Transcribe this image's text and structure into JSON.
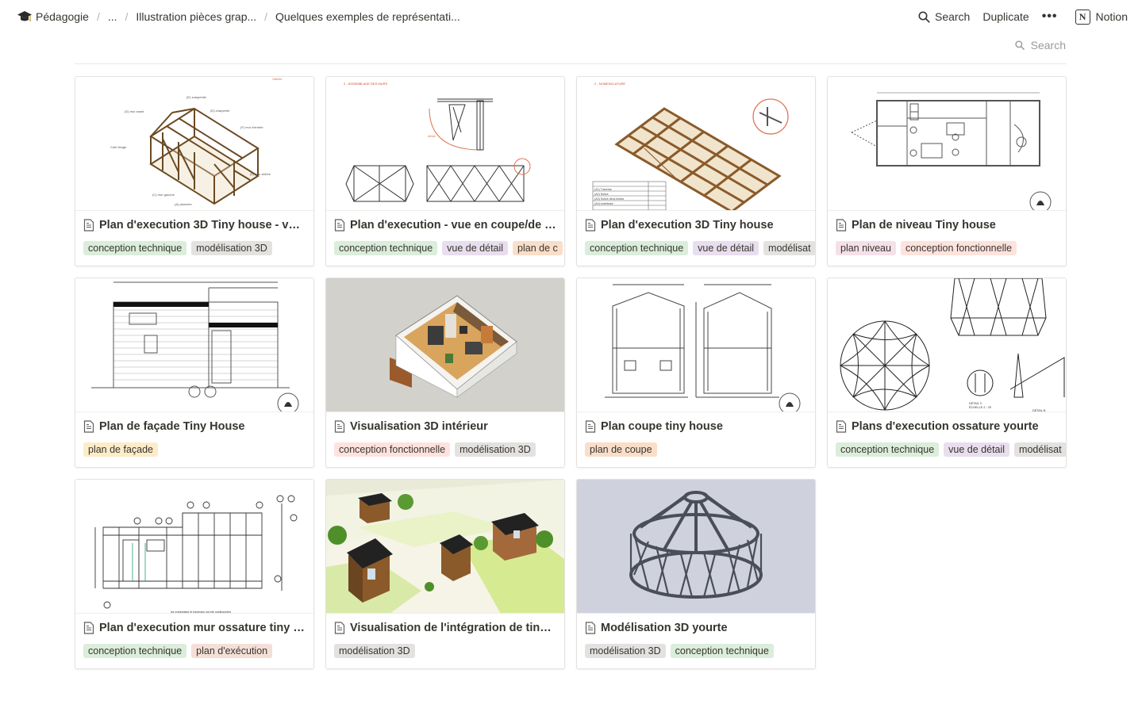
{
  "breadcrumb": {
    "items": [
      {
        "label": "Pédagogie"
      },
      {
        "label": "..."
      },
      {
        "label": "Illustration pièces grap..."
      },
      {
        "label": "Quelques exemples de représentati..."
      }
    ]
  },
  "actions": {
    "search": "Search",
    "duplicate": "Duplicate",
    "more": "•••",
    "notion": "Notion"
  },
  "database": {
    "search_placeholder": "Search"
  },
  "tag_colors": {
    "conception technique": "#dbeddb",
    "modélisation 3D": "#e3e2e0",
    "vue de détail": "#e8deee",
    "plan de coupe": "#fadec9",
    "plan niveau": "#f5e0e9",
    "conception fonctionnelle": "#ffe2dd",
    "plan de façade": "#fdecc8",
    "plan d'exécution": "#f4dfd6"
  },
  "cards": [
    {
      "title": "Plan d'execution 3D Tiny house - vue ...",
      "tags": [
        "conception technique",
        "modélisation 3D"
      ]
    },
    {
      "title": "Plan d'execution - vue en coupe/de d...",
      "tags": [
        "conception technique",
        "vue de détail",
        "plan de c"
      ]
    },
    {
      "title": "Plan d'execution 3D Tiny house",
      "tags": [
        "conception technique",
        "vue de détail",
        "modélisat"
      ]
    },
    {
      "title": "Plan de niveau Tiny house",
      "tags": [
        "plan niveau",
        "conception fonctionnelle"
      ]
    },
    {
      "title": "Plan de façade Tiny House",
      "tags": [
        "plan de façade"
      ]
    },
    {
      "title": "Visualisation 3D intérieur",
      "tags": [
        "conception fonctionnelle",
        "modélisation 3D"
      ]
    },
    {
      "title": "Plan coupe tiny house",
      "tags": [
        "plan de coupe"
      ]
    },
    {
      "title": "Plans d'execution ossature yourte",
      "tags": [
        "conception technique",
        "vue de détail",
        "modélisat"
      ]
    },
    {
      "title": "Plan d'execution mur ossature tiny ho...",
      "tags": [
        "conception technique",
        "plan d'exécution"
      ]
    },
    {
      "title": "Visualisation de l'intégration de tiny h...",
      "tags": [
        "modélisation 3D"
      ]
    },
    {
      "title": "Modélisation 3D yourte",
      "tags": [
        "modélisation 3D",
        "conception technique"
      ]
    }
  ]
}
